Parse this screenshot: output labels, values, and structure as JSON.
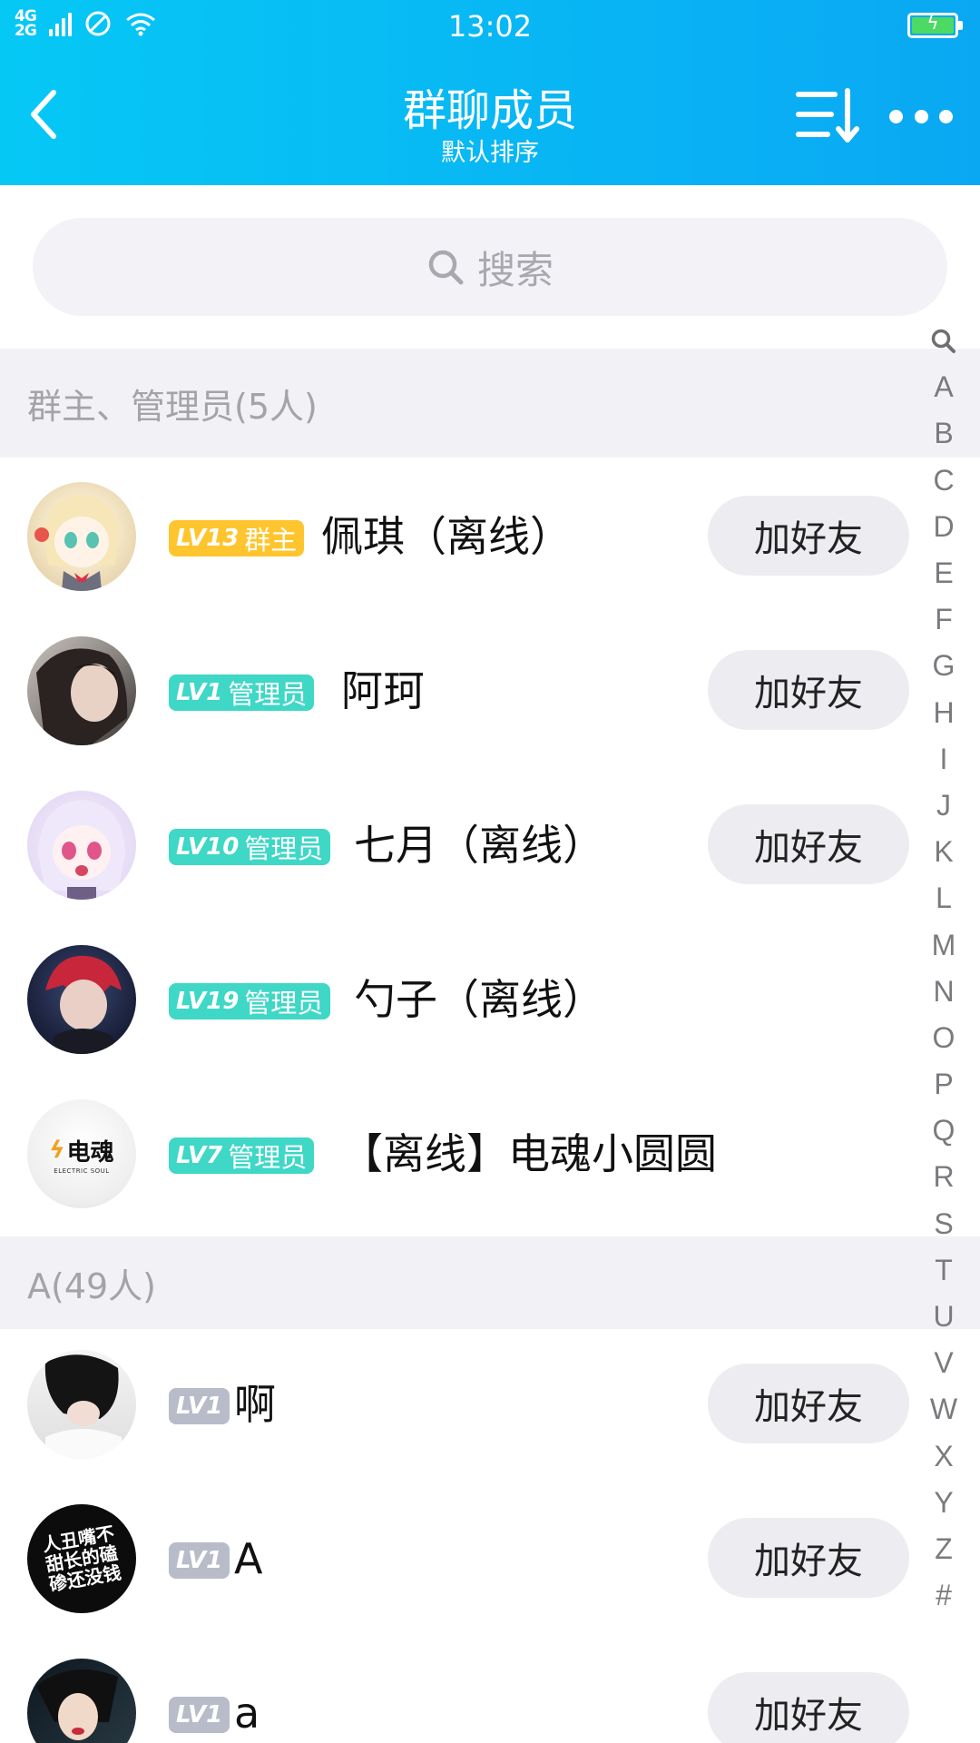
{
  "status_bar": {
    "network_top": "4G",
    "network_bottom": "2G",
    "time": "13:02"
  },
  "header": {
    "title": "群聊成员",
    "subtitle": "默认排序",
    "back_icon": "chevron-left-icon",
    "sort_icon": "sort-icon",
    "more_icon": "more-icon"
  },
  "search": {
    "placeholder": "搜索",
    "icon": "search-icon"
  },
  "sections": [
    {
      "title": "群主、管理员(5人)",
      "members": [
        {
          "level": "LV13",
          "role": "群主",
          "name": "佩琪（离线）",
          "add_label": "加好友"
        },
        {
          "level": "LV1",
          "role": "管理员",
          "name": "阿珂",
          "add_label": "加好友"
        },
        {
          "level": "LV10",
          "role": "管理员",
          "name": "七月（离线）",
          "add_label": "加好友"
        },
        {
          "level": "LV19",
          "role": "管理员",
          "name": "勺子（离线）",
          "add_label": ""
        },
        {
          "level": "LV7",
          "role": "管理员",
          "name": "【离线】电魂小圆圆",
          "add_label": ""
        }
      ]
    },
    {
      "title": "A(49人)",
      "members": [
        {
          "level": "LV1",
          "role": "",
          "name": "啊",
          "add_label": "加好友"
        },
        {
          "level": "LV1",
          "role": "",
          "name": "A",
          "add_label": "加好友"
        },
        {
          "level": "LV1",
          "role": "",
          "name": "a",
          "add_label": "加好友"
        }
      ]
    }
  ],
  "avatar_texts": {
    "dianhun_logo": "电魂",
    "dianhun_sub": "ELECTRIC SOUL",
    "quote_avatar": "人丑嘴不甜长的磕碜还没钱"
  },
  "index_letters": [
    "A",
    "B",
    "C",
    "D",
    "E",
    "F",
    "G",
    "H",
    "I",
    "J",
    "K",
    "L",
    "M",
    "N",
    "O",
    "P",
    "Q",
    "R",
    "S",
    "T",
    "U",
    "V",
    "W",
    "X",
    "Y",
    "Z",
    "#"
  ],
  "colors": {
    "header_start": "#06c8f5",
    "header_end": "#0aa8f3",
    "owner_badge": "#ffc52e",
    "admin_badge": "#3fd7c6",
    "member_badge": "#b8bcc9"
  }
}
